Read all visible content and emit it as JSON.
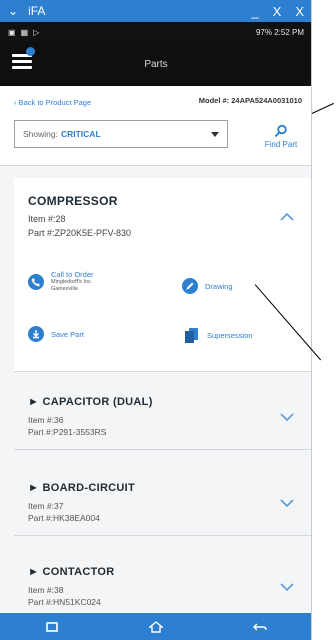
{
  "window": {
    "title": "iFA",
    "controls": [
      "_",
      "X",
      "X"
    ]
  },
  "status": {
    "right_text": "97% 2:52 PM"
  },
  "header": {
    "title": "Parts"
  },
  "topinfo": {
    "back_label": "‹ Back to Product Page",
    "model_label": "Model #: 24APA524A0031010",
    "showing_label": "Showing:",
    "showing_value": "CRITICAL",
    "find_part_label": "Find Part"
  },
  "expanded": {
    "name": "COMPRESSOR",
    "item": "Item #:28",
    "part": "Part #:ZP20K5E-PFV-830",
    "actions": {
      "call_label": "Call to Order",
      "call_sub1": "Mingledorff's Inc.",
      "call_sub2": "Gainesville",
      "drawing_label": "Drawing",
      "save_label": "Save Part",
      "supersession_label": "Supersession"
    }
  },
  "parts": [
    {
      "name": "CAPACITOR (DUAL)",
      "item": "Item #:36",
      "part": "Part #:P291-3553RS"
    },
    {
      "name": "BOARD-CIRCUIT",
      "item": "Item #:37",
      "part": "Part #:HK38EA004"
    },
    {
      "name": "CONTACTOR",
      "item": "Item #:38",
      "part": "Part #:HN51KC024"
    }
  ],
  "colors": {
    "accent": "#2d7fd0",
    "appbar": "#0f0f10",
    "statusbar": "#111111"
  }
}
